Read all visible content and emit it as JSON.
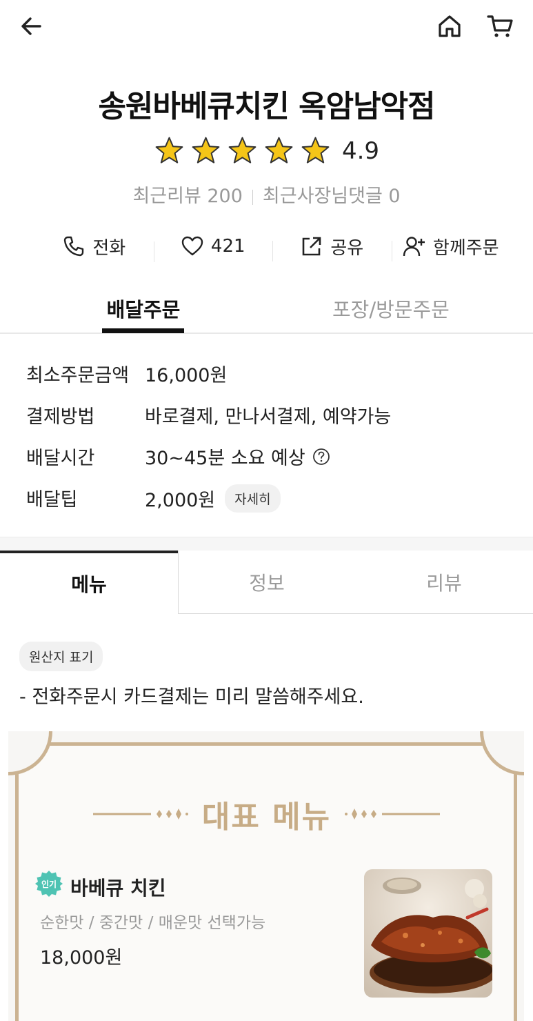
{
  "header": {
    "back_icon": "arrow-left-icon",
    "home_icon": "home-icon",
    "cart_icon": "cart-icon"
  },
  "store": {
    "name": "송원바베큐치킨 옥암남악점",
    "rating": "4.9",
    "rating_stars": 5,
    "recent_reviews": "최근리뷰 200",
    "owner_replies": "최근사장님댓글 0"
  },
  "actions": {
    "call": "전화",
    "likes": "421",
    "share": "공유",
    "group_order": "함께주문"
  },
  "order_tabs": {
    "delivery": "배달주문",
    "pickup": "포장/방문주문"
  },
  "info": {
    "min_order_label": "최소주문금액",
    "min_order_value": "16,000원",
    "payment_label": "결제방법",
    "payment_value": "바로결제, 만나서결제, 예약가능",
    "delivery_time_label": "배달시간",
    "delivery_time_value": "30~45분 소요 예상",
    "delivery_tip_label": "배달팁",
    "delivery_tip_value": "2,000원",
    "detail_button": "자세히"
  },
  "menu_tabs": {
    "menu": "메뉴",
    "info": "정보",
    "review": "리뷰"
  },
  "origin_label": "원산지 표기",
  "notice": "- 전화주문시 카드결제는 미리 말씀해주세요.",
  "banner": {
    "title": "대표 메뉴"
  },
  "item": {
    "badge": "인기",
    "name": "바베큐 치킨",
    "description": "순한맛 / 중간맛 / 매운맛 선택가능",
    "price": "18,000원"
  },
  "colors": {
    "star": "#F5C518",
    "badge": "#4FC3B3",
    "banner_gold": "#C7AC86"
  }
}
